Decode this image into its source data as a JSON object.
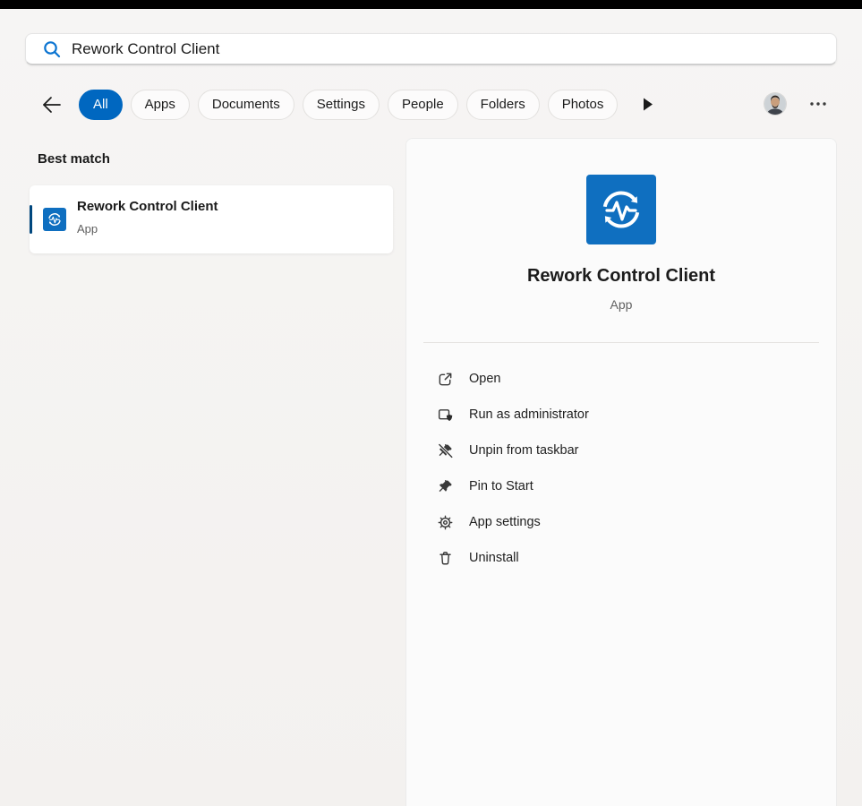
{
  "search": {
    "value": "Rework Control Client",
    "icon": "search-icon"
  },
  "tabs": [
    {
      "label": "All",
      "selected": true
    },
    {
      "label": "Apps",
      "selected": false
    },
    {
      "label": "Documents",
      "selected": false
    },
    {
      "label": "Settings",
      "selected": false
    },
    {
      "label": "People",
      "selected": false
    },
    {
      "label": "Folders",
      "selected": false
    },
    {
      "label": "Photos",
      "selected": false
    }
  ],
  "results": {
    "section_title": "Best match",
    "best_match": {
      "name": "Rework Control Client",
      "type": "App"
    }
  },
  "preview": {
    "name": "Rework Control Client",
    "type": "App",
    "actions": [
      {
        "label": "Open",
        "icon": "open-external-icon"
      },
      {
        "label": "Run as administrator",
        "icon": "admin-shield-icon"
      },
      {
        "label": "Unpin from taskbar",
        "icon": "unpin-icon"
      },
      {
        "label": "Pin to Start",
        "icon": "pin-icon"
      },
      {
        "label": "App settings",
        "icon": "gear-icon"
      },
      {
        "label": "Uninstall",
        "icon": "trash-icon"
      }
    ]
  },
  "colors": {
    "accent": "#0067c0",
    "accent-dark": "#00477e",
    "app-icon-blue": "#0f6fc0",
    "background": "#f4f3f1",
    "panel": "#fbfbfb"
  }
}
